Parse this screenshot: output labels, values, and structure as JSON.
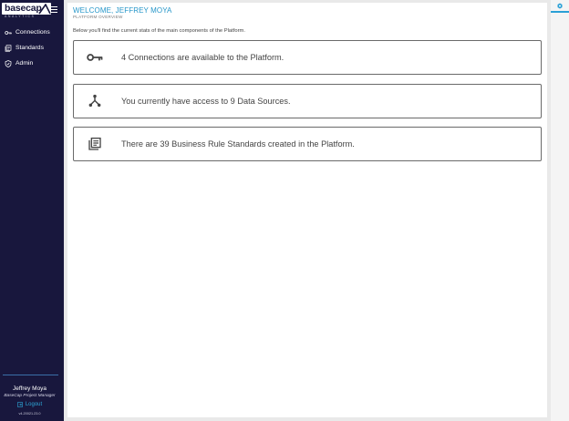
{
  "app": {
    "logo_text": "basecap",
    "logo_subtext": "ANALYTICS"
  },
  "sidebar": {
    "items": [
      {
        "label": "Connections",
        "icon": "key-icon"
      },
      {
        "label": "Standards",
        "icon": "documents-icon"
      },
      {
        "label": "Admin",
        "icon": "shield-icon"
      }
    ],
    "user_name": "Jeffrey Moya",
    "user_role": "BaseCap Project Manager",
    "logout_label": "Logout",
    "version": "v4.20021.23.0"
  },
  "header": {
    "welcome": "WELCOME, JEFFREY MOYA",
    "subtitle": "PLATFORM OVERVIEW"
  },
  "main": {
    "intro": "Below you'll find the current stats of the main components of the Platform.",
    "cards": [
      {
        "icon": "key-icon",
        "text": "4 Connections are available to the Platform."
      },
      {
        "icon": "data-sources-icon",
        "text": "You currently have access to 9 Data Sources."
      },
      {
        "icon": "library-books-icon",
        "text": "There are 39 Business Rule Standards created in the Platform."
      }
    ]
  },
  "colors": {
    "sidebar_bg": "#18173d",
    "accent": "#2596c9",
    "page_bg": "#e9e9e9"
  }
}
